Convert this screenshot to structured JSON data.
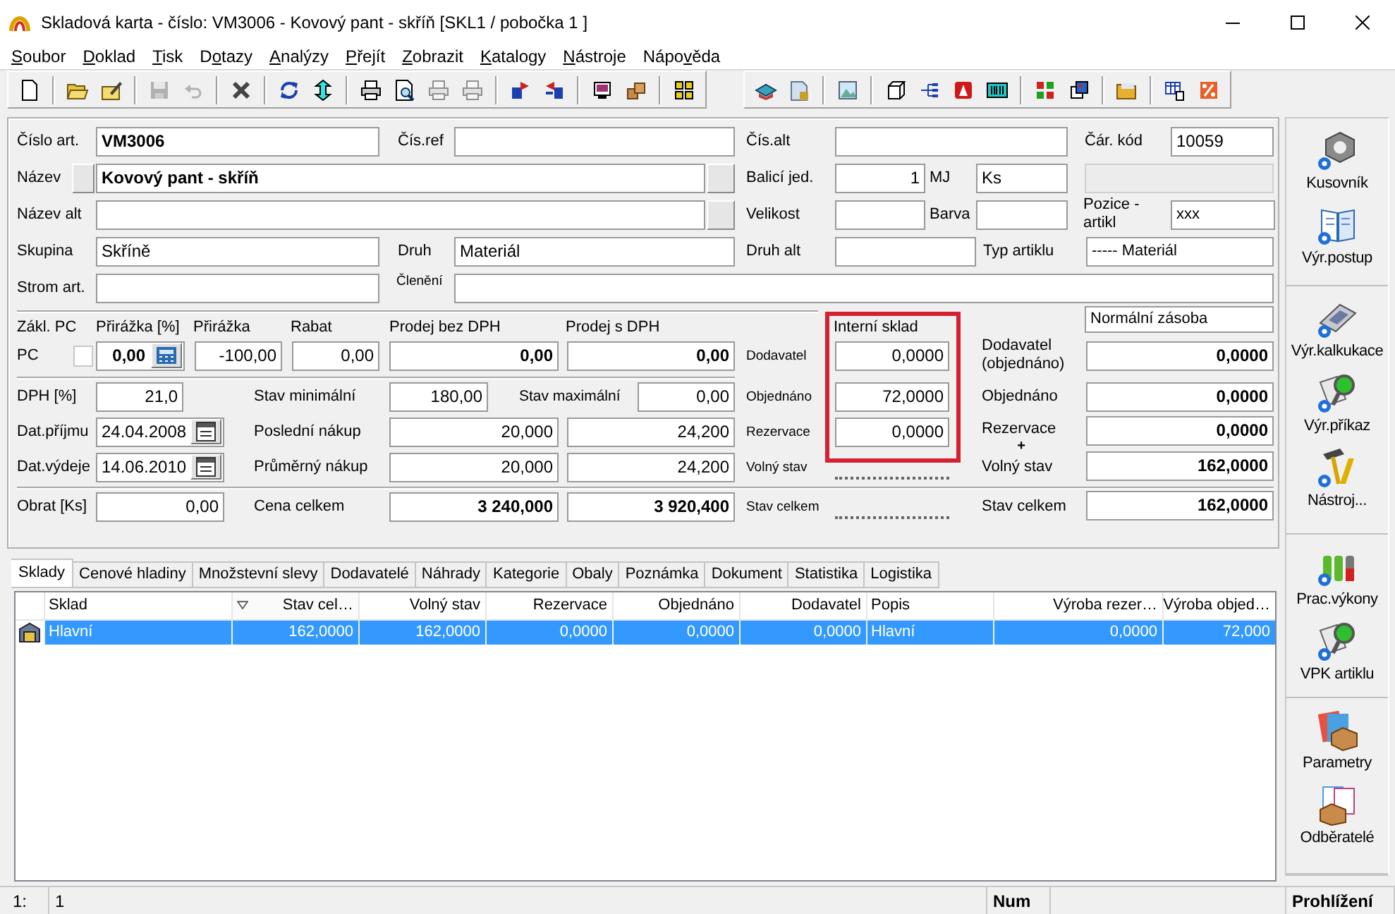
{
  "window": {
    "title": "Skladová karta - číslo: VM3006 - Kovový pant - skříň [SKL1 / pobočka 1 ]"
  },
  "menu": [
    {
      "accel": "S",
      "rest": "oubor"
    },
    {
      "accel": "D",
      "rest": "oklad"
    },
    {
      "accel": "T",
      "rest": "isk"
    },
    {
      "lead": "D",
      "accel": "o",
      "rest": "tazy"
    },
    {
      "accel": "A",
      "rest": "nalýzy"
    },
    {
      "accel": "P",
      "rest": "řejít"
    },
    {
      "accel": "Z",
      "rest": "obrazit"
    },
    {
      "accel": "K",
      "rest": "atalogy"
    },
    {
      "accel": "N",
      "rest": "ástroje"
    },
    {
      "lead": "Nápo",
      "accel": "v",
      "rest": "ěda"
    }
  ],
  "toolbars": [
    {
      "groups": [
        {
          "buttons": [
            {
              "disabled": false
            }
          ]
        },
        {
          "buttons": [
            {
              "disabled": false
            },
            {
              "disabled": false
            }
          ]
        },
        {
          "buttons": [
            {
              "disabled": true
            },
            {
              "disabled": true
            }
          ]
        },
        {
          "buttons": [
            {
              "disabled": false
            }
          ]
        },
        {
          "buttons": [
            {
              "disabled": false
            },
            {
              "disabled": false
            }
          ]
        },
        {
          "buttons": [
            {
              "disabled": false
            },
            {
              "disabled": false
            },
            {
              "disabled": true
            },
            {
              "disabled": true
            }
          ]
        },
        {
          "buttons": [
            {
              "disabled": false
            },
            {
              "disabled": false
            }
          ]
        },
        {
          "buttons": [
            {
              "disabled": false
            },
            {
              "disabled": false
            }
          ]
        },
        {
          "buttons": [
            {
              "disabled": false
            }
          ]
        }
      ]
    },
    {
      "groups": [
        {
          "buttons": [
            {
              "disabled": false
            },
            {
              "disabled": false
            }
          ]
        },
        {
          "buttons": [
            {
              "disabled": false
            }
          ]
        },
        {
          "buttons": [
            {
              "disabled": false
            },
            {
              "disabled": false
            },
            {
              "disabled": false
            },
            {
              "disabled": false
            }
          ]
        },
        {
          "buttons": [
            {
              "disabled": false
            },
            {
              "disabled": false
            }
          ]
        },
        {
          "buttons": [
            {
              "disabled": false
            }
          ]
        },
        {
          "buttons": [
            {
              "disabled": false
            },
            {
              "disabled": false
            }
          ]
        }
      ]
    }
  ],
  "form": {
    "items": [
      {
        "kind": "label",
        "text": "Číslo art."
      },
      {
        "kind": "input",
        "value": "VM3006",
        "disabled": false
      },
      {
        "kind": "label",
        "text": "Čís.ref"
      },
      {
        "kind": "input",
        "disabled": false
      },
      {
        "kind": "label",
        "text": "Čís.alt"
      },
      {
        "kind": "input",
        "disabled": false
      },
      {
        "kind": "label",
        "text": "Čár. kód"
      },
      {
        "kind": "input",
        "value": "10059",
        "disabled": false
      },
      {
        "kind": "label",
        "text": "Název"
      },
      {
        "kind": "button"
      },
      {
        "kind": "input",
        "value": "Kovový pant - skříň",
        "disabled": false
      },
      {
        "kind": "button"
      },
      {
        "kind": "label",
        "text": "Balicí jed."
      },
      {
        "kind": "input",
        "value": "1",
        "disabled": false
      },
      {
        "kind": "label",
        "text": "MJ"
      },
      {
        "kind": "input",
        "value": "Ks",
        "disabled": false
      },
      {
        "kind": "input",
        "disabled": true
      },
      {
        "kind": "label",
        "text": "Název alt"
      },
      {
        "kind": "input",
        "disabled": false
      },
      {
        "kind": "button"
      },
      {
        "kind": "label",
        "text": "Velikost"
      },
      {
        "kind": "input",
        "disabled": false
      },
      {
        "kind": "label",
        "text": "Barva"
      },
      {
        "kind": "input",
        "disabled": false
      },
      {
        "kind": "label",
        "text": "Pozice - artikl"
      },
      {
        "kind": "input",
        "value": "xxx",
        "disabled": false
      },
      {
        "kind": "label",
        "text": "Skupina"
      },
      {
        "kind": "input",
        "value": "Skříně",
        "disabled": false
      },
      {
        "kind": "label",
        "text": "Druh"
      },
      {
        "kind": "input",
        "value": "Materiál",
        "disabled": false
      },
      {
        "kind": "label",
        "text": "Druh alt"
      },
      {
        "kind": "input",
        "disabled": false
      },
      {
        "kind": "label",
        "text": "Typ artiklu"
      },
      {
        "kind": "input",
        "value": "----- Materiál",
        "disabled": false
      },
      {
        "kind": "label",
        "text": "Strom art."
      },
      {
        "kind": "input",
        "disabled": false
      },
      {
        "kind": "small_label",
        "text": "Členění"
      },
      {
        "kind": "input",
        "disabled": false
      },
      {
        "kind": "label",
        "text": "Zákl. PC"
      },
      {
        "kind": "label",
        "text": "Přirážka [%]"
      },
      {
        "kind": "label",
        "text": "Přirážka"
      },
      {
        "kind": "label",
        "text": "Rabat"
      },
      {
        "kind": "label",
        "text": "Prodej bez DPH"
      },
      {
        "kind": "label",
        "text": "Prodej s DPH"
      },
      {
        "kind": "frame"
      },
      {
        "kind": "label",
        "text": "Interní sklad"
      },
      {
        "kind": "input",
        "value": "Normální zásoba",
        "disabled": false
      },
      {
        "kind": "label",
        "text": "PC"
      },
      {
        "kind": "checkbox",
        "checked": false
      },
      {
        "kind": "calc_input",
        "value": "0,00",
        "disabled": false
      },
      {
        "kind": "input",
        "value": "-100,00",
        "disabled": false
      },
      {
        "kind": "input",
        "value": "0,00",
        "disabled": false
      },
      {
        "kind": "input",
        "value": "0,00",
        "disabled": false
      },
      {
        "kind": "input",
        "value": "0,00",
        "disabled": false
      },
      {
        "kind": "small_label",
        "text": "Dodavatel"
      },
      {
        "kind": "input",
        "value": "0,0000",
        "disabled": false
      },
      {
        "kind": "label",
        "text": "Dodavatel (objednáno)"
      },
      {
        "kind": "input",
        "value": "0,0000",
        "disabled": false
      },
      {
        "kind": "label",
        "text": "DPH [%]"
      },
      {
        "kind": "input",
        "value": "21,0",
        "disabled": false
      },
      {
        "kind": "label",
        "text": "Stav minimální"
      },
      {
        "kind": "input",
        "value": "180,00",
        "disabled": false
      },
      {
        "kind": "label",
        "text": "Stav maximální"
      },
      {
        "kind": "input",
        "value": "0,00",
        "disabled": false
      },
      {
        "kind": "small_label",
        "text": "Objednáno"
      },
      {
        "kind": "input",
        "value": "72,0000",
        "disabled": false
      },
      {
        "kind": "label",
        "text": "Objednáno"
      },
      {
        "kind": "input",
        "value": "0,0000",
        "disabled": false
      },
      {
        "kind": "label",
        "text": "Dat.příjmu"
      },
      {
        "kind": "date_input",
        "value": "24.04.2008",
        "disabled": false
      },
      {
        "kind": "label",
        "text": "Poslední nákup"
      },
      {
        "kind": "input",
        "value": "20,000",
        "disabled": false
      },
      {
        "kind": "input",
        "value": "24,200",
        "disabled": false
      },
      {
        "kind": "small_label",
        "text": "Rezervace"
      },
      {
        "kind": "input",
        "value": "0,0000",
        "disabled": false
      },
      {
        "kind": "label",
        "text": "Rezervace"
      },
      {
        "kind": "label",
        "text": "+"
      },
      {
        "kind": "input",
        "value": "0,0000",
        "disabled": false
      },
      {
        "kind": "label",
        "text": "Dat.výdeje"
      },
      {
        "kind": "date_input",
        "value": "14.06.2010",
        "disabled": false
      },
      {
        "kind": "label",
        "text": "Průměrný nákup"
      },
      {
        "kind": "input",
        "value": "20,000",
        "disabled": false
      },
      {
        "kind": "input",
        "value": "24,200",
        "disabled": false
      },
      {
        "kind": "small_label",
        "text": "Volný stav"
      },
      {
        "kind": "dots"
      },
      {
        "kind": "label",
        "text": "Volný stav"
      },
      {
        "kind": "input",
        "value": "162,0000",
        "disabled": false
      },
      {
        "kind": "label",
        "text": "Obrat [Ks]"
      },
      {
        "kind": "input",
        "value": "0,00",
        "disabled": false
      },
      {
        "kind": "label",
        "text": "Cena celkem"
      },
      {
        "kind": "input",
        "value": "3 240,000",
        "disabled": false
      },
      {
        "kind": "input",
        "value": "3 920,400",
        "disabled": false
      },
      {
        "kind": "small_label",
        "text": "Stav celkem"
      },
      {
        "kind": "dots"
      },
      {
        "kind": "label",
        "text": "Stav celkem"
      },
      {
        "kind": "input",
        "value": "162,0000",
        "disabled": false
      }
    ]
  },
  "sidebar": {
    "groups": [
      {
        "items": [
          {
            "label": "Kusovník"
          },
          {
            "label": "Výr.postup"
          }
        ]
      },
      {
        "items": [
          {
            "label": "Výr.kalkukace"
          },
          {
            "label": "Výr.příkaz"
          },
          {
            "label": "Nástroj..."
          }
        ]
      },
      {
        "items": [
          {
            "label": "Prac.výkony"
          },
          {
            "label": "VPK artiklu"
          }
        ]
      },
      {
        "items": [
          {
            "label": "Parametry"
          },
          {
            "label": "Odběratelé"
          }
        ]
      }
    ]
  },
  "tabs": [
    {
      "label": "Sklady",
      "selected": true
    },
    {
      "label": "Cenové hladiny",
      "selected": false
    },
    {
      "label": "Množstevní slevy",
      "selected": false
    },
    {
      "label": "Dodavatelé",
      "selected": false
    },
    {
      "label": "Náhrady",
      "selected": false
    },
    {
      "label": "Kategorie",
      "selected": false
    },
    {
      "label": "Obaly",
      "selected": false
    },
    {
      "label": "Poznámka",
      "selected": false
    },
    {
      "label": "Dokument",
      "selected": false
    },
    {
      "label": "Statistika",
      "selected": false
    },
    {
      "label": "Logistika",
      "selected": false
    }
  ],
  "table": {
    "columns": [
      {
        "label": "Sklad",
        "sorted": false
      },
      {
        "label": "Stav cel…",
        "sorted": true
      },
      {
        "label": "Volný stav",
        "sorted": false
      },
      {
        "label": "Rezervace",
        "sorted": false
      },
      {
        "label": "Objednáno",
        "sorted": false
      },
      {
        "label": "Dodavatel",
        "sorted": false
      },
      {
        "label": "Popis",
        "sorted": false
      },
      {
        "label": "Výroba rezer…",
        "sorted": false
      },
      {
        "label": "Výroba objed…",
        "sorted": false
      }
    ],
    "rows": [
      {
        "selected": true,
        "cells": [
          "Hlavní",
          "162,0000",
          "162,0000",
          "0,0000",
          "0,0000",
          "0,0000",
          "Hlavní",
          "0,0000",
          "72,000"
        ]
      }
    ]
  },
  "status_bar": {
    "cells": [
      "1:",
      "1",
      "Num",
      "Prohlížení"
    ]
  }
}
